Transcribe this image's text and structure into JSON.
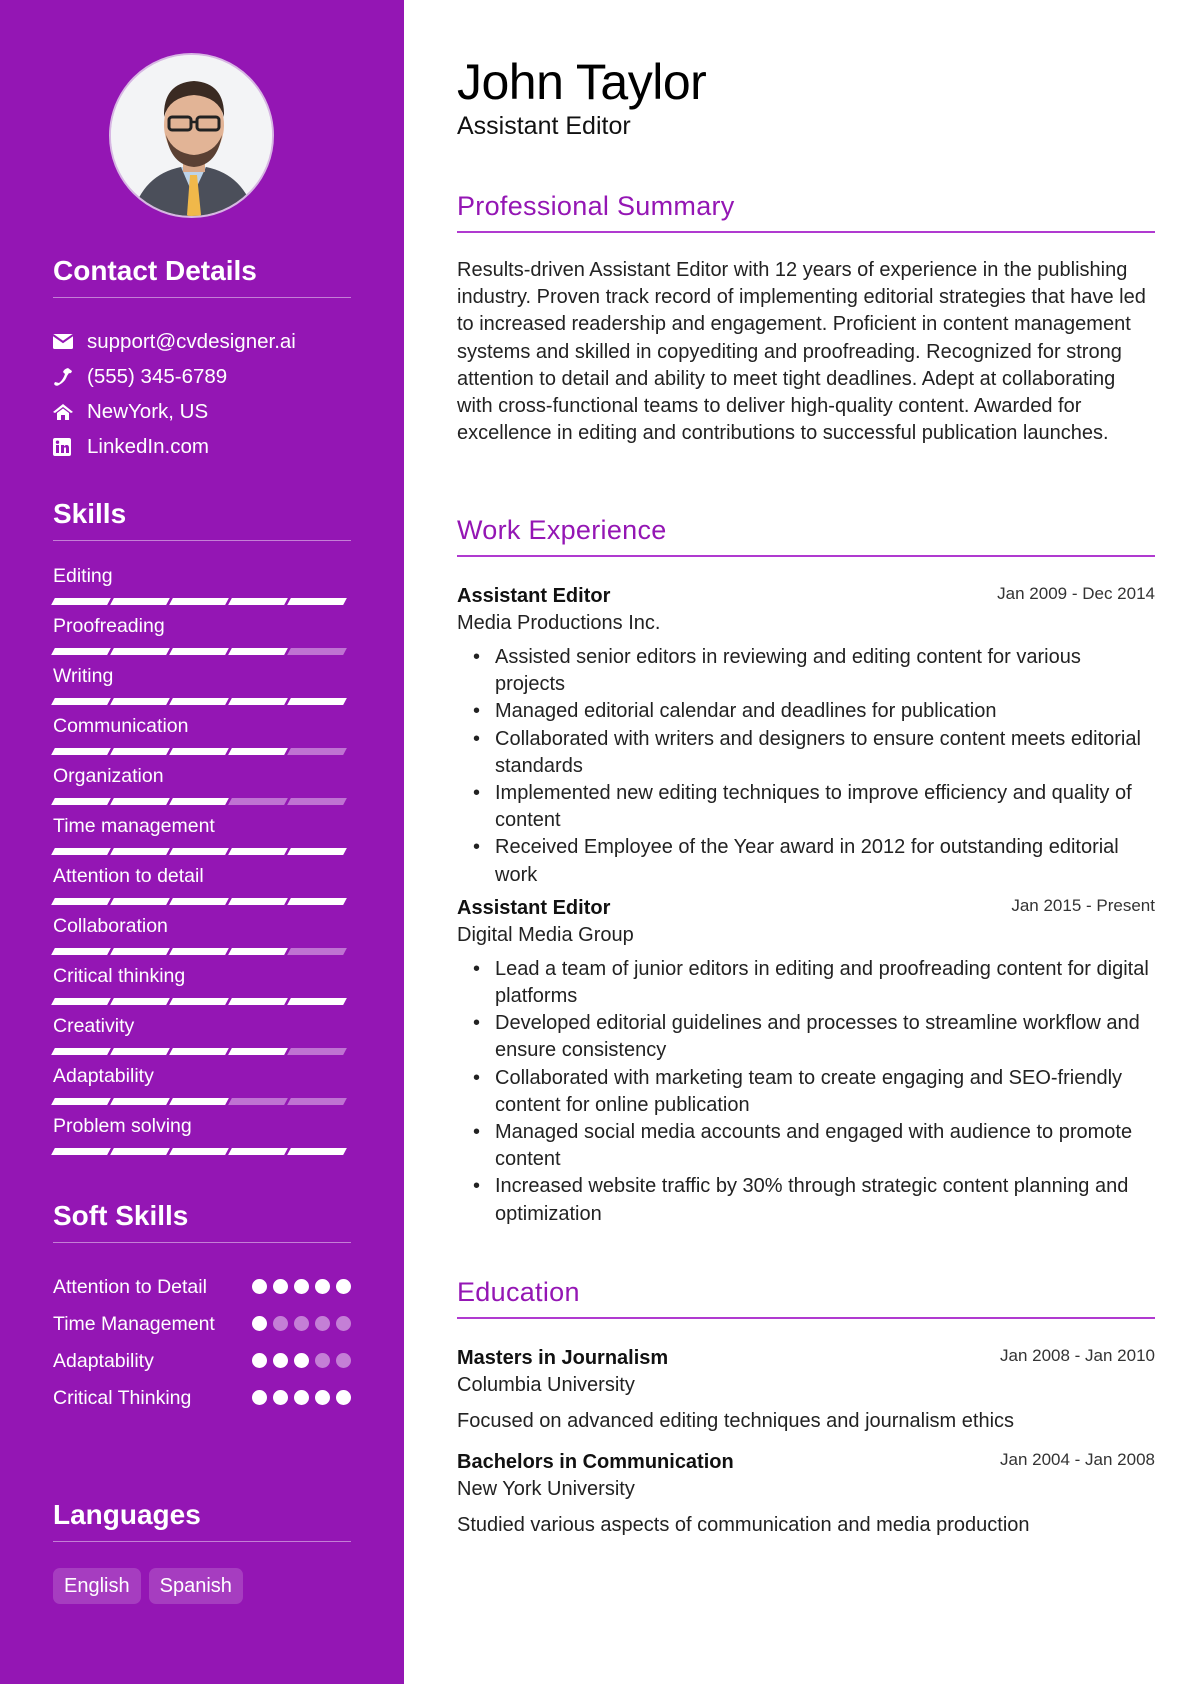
{
  "profile": {
    "name": "John Taylor",
    "role": "Assistant Editor",
    "photo_alt": "Profile photo of John Taylor"
  },
  "theme": {
    "accent": "#9416b4",
    "sidebar_bg": "#9416b4"
  },
  "contact": {
    "title": "Contact Details",
    "items": [
      {
        "icon": "envelope-icon",
        "text": "support@cvdesigner.ai"
      },
      {
        "icon": "phone-icon",
        "text": "(555) 345-6789"
      },
      {
        "icon": "home-icon",
        "text": "NewYork, US"
      },
      {
        "icon": "linkedin-icon",
        "text": "LinkedIn.com"
      }
    ]
  },
  "skills": {
    "title": "Skills",
    "max_level": 5,
    "items": [
      {
        "name": "Editing",
        "level": 5
      },
      {
        "name": "Proofreading",
        "level": 4
      },
      {
        "name": "Writing",
        "level": 5
      },
      {
        "name": "Communication",
        "level": 4
      },
      {
        "name": "Organization",
        "level": 3
      },
      {
        "name": "Time management",
        "level": 5
      },
      {
        "name": "Attention to detail",
        "level": 5
      },
      {
        "name": "Collaboration",
        "level": 4
      },
      {
        "name": "Critical thinking",
        "level": 5
      },
      {
        "name": "Creativity",
        "level": 4
      },
      {
        "name": "Adaptability",
        "level": 3
      },
      {
        "name": "Problem solving",
        "level": 5
      }
    ]
  },
  "soft_skills": {
    "title": "Soft Skills",
    "max_level": 5,
    "items": [
      {
        "name": "Attention to Detail",
        "level": 5
      },
      {
        "name": "Time Management",
        "level": 1
      },
      {
        "name": "Adaptability",
        "level": 3
      },
      {
        "name": "Critical Thinking",
        "level": 5
      }
    ]
  },
  "languages": {
    "title": "Languages",
    "items": [
      "English",
      "Spanish"
    ]
  },
  "summary": {
    "title": "Professional Summary",
    "text": "Results-driven Assistant Editor with 12 years of experience in the publishing industry. Proven track record of implementing editorial strategies that have led to increased readership and engagement. Proficient in content management systems and skilled in copyediting and proofreading. Recognized for strong attention to detail and ability to meet tight deadlines. Adept at collaborating with cross-functional teams to deliver high-quality content. Awarded for excellence in editing and contributions to successful publication launches."
  },
  "experience": {
    "title": "Work Experience",
    "items": [
      {
        "title": "Assistant Editor",
        "dates": "Jan 2009 - Dec 2014",
        "org": "Media Productions Inc.",
        "bullets": [
          "Assisted senior editors in reviewing and editing content for various projects",
          "Managed editorial calendar and deadlines for publication",
          "Collaborated with writers and designers to ensure content meets editorial standards",
          "Implemented new editing techniques to improve efficiency and quality of content",
          "Received Employee of the Year award in 2012 for outstanding editorial work"
        ]
      },
      {
        "title": "Assistant Editor",
        "dates": "Jan 2015 - Present",
        "org": "Digital Media Group",
        "bullets": [
          "Lead a team of junior editors in editing and proofreading content for digital platforms",
          "Developed editorial guidelines and processes to streamline workflow and ensure consistency",
          "Collaborated with marketing team to create engaging and SEO-friendly content for online publication",
          "Managed social media accounts and engaged with audience to promote content",
          "Increased website traffic by 30% through strategic content planning and optimization"
        ]
      }
    ]
  },
  "education": {
    "title": "Education",
    "items": [
      {
        "title": "Masters in Journalism",
        "dates": "Jan 2008 - Jan 2010",
        "org": "Columbia University",
        "desc": "Focused on advanced editing techniques and journalism ethics"
      },
      {
        "title": "Bachelors in Communication",
        "dates": "Jan 2004 - Jan 2008",
        "org": "New York University",
        "desc": "Studied various aspects of communication and media production"
      }
    ]
  }
}
